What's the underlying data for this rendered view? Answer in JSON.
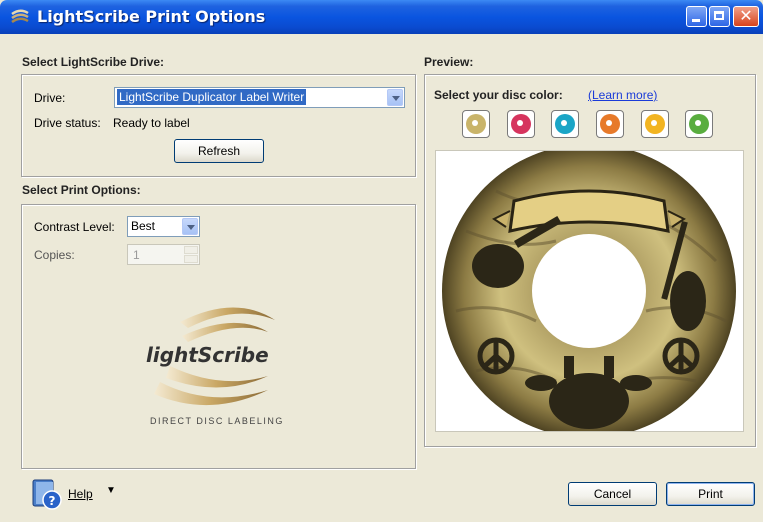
{
  "window": {
    "title": "LightScribe Print Options"
  },
  "drive_section": {
    "title": "Select LightScribe Drive:",
    "drive_label": "Drive:",
    "drive_value": "LightScribe Duplicator Label Writer",
    "status_label": "Drive status:",
    "status_value": "Ready to label",
    "refresh_label": "Refresh"
  },
  "print_section": {
    "title": "Select Print Options:",
    "contrast_label": "Contrast Level:",
    "contrast_value": "Best",
    "copies_label": "Copies:",
    "copies_value": "1",
    "logo_text": "lightScribe",
    "logo_tagline": "DIRECT DISC LABELING"
  },
  "preview_section": {
    "title": "Preview:",
    "disc_color_label": "Select your disc color:",
    "learn_more": "(Learn more)",
    "disc_colors": [
      "#c9b46a",
      "#d6345e",
      "#1aa5c6",
      "#e77a2a",
      "#f2b421",
      "#59ad3f"
    ]
  },
  "footer": {
    "help_label": "Help",
    "cancel_label": "Cancel",
    "print_label": "Print"
  }
}
